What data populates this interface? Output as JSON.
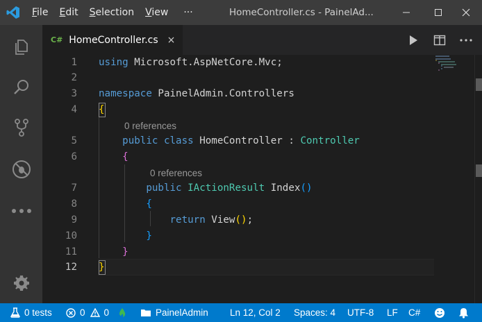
{
  "titlebar": {
    "menu": [
      {
        "label": "File",
        "accel": "F"
      },
      {
        "label": "Edit",
        "accel": "E"
      },
      {
        "label": "Selection",
        "accel": "S"
      },
      {
        "label": "View",
        "accel": "V"
      }
    ],
    "more": "···",
    "window_title": "HomeController.cs - PainelAd..."
  },
  "tab": {
    "lang_badge": "C#",
    "label": "HomeController.cs",
    "close": "×"
  },
  "editor": {
    "lines": [
      {
        "n": "1",
        "tokens": [
          {
            "t": "using",
            "c": "kw"
          },
          {
            "t": " Microsoft.AspNetCore.Mvc;",
            "c": ""
          }
        ]
      },
      {
        "n": "2",
        "tokens": []
      },
      {
        "n": "3",
        "tokens": [
          {
            "t": "namespace",
            "c": "kw"
          },
          {
            "t": " PainelAdmin.Controllers",
            "c": ""
          }
        ]
      },
      {
        "n": "4",
        "tokens": [
          {
            "t": "{",
            "c": "br1"
          }
        ]
      },
      {
        "n": "5",
        "lens": "0 references",
        "tokens": [
          {
            "t": "    public",
            "c": "kw"
          },
          {
            "t": " ",
            "c": ""
          },
          {
            "t": "class",
            "c": "kw"
          },
          {
            "t": " HomeController : ",
            "c": ""
          },
          {
            "t": "Controller",
            "c": "ty"
          }
        ]
      },
      {
        "n": "6",
        "tokens": [
          {
            "t": "    {",
            "c": "br2"
          }
        ]
      },
      {
        "n": "7",
        "lens": "0 references",
        "tokens": [
          {
            "t": "        public",
            "c": "kw"
          },
          {
            "t": " ",
            "c": ""
          },
          {
            "t": "IActionResult",
            "c": "ty"
          },
          {
            "t": " Index",
            "c": ""
          },
          {
            "t": "()",
            "c": "br3"
          }
        ]
      },
      {
        "n": "8",
        "tokens": [
          {
            "t": "        {",
            "c": "br3"
          }
        ]
      },
      {
        "n": "9",
        "tokens": [
          {
            "t": "            return",
            "c": "kw"
          },
          {
            "t": " View",
            "c": ""
          },
          {
            "t": "()",
            "c": "br1"
          },
          {
            "t": ";",
            "c": ""
          }
        ]
      },
      {
        "n": "10",
        "tokens": [
          {
            "t": "        }",
            "c": "br3"
          }
        ]
      },
      {
        "n": "11",
        "tokens": [
          {
            "t": "    }",
            "c": "br2"
          }
        ]
      },
      {
        "n": "12",
        "tokens": [
          {
            "t": "}",
            "c": "br1"
          }
        ]
      }
    ]
  },
  "statusbar": {
    "tests": "0 tests",
    "errors": "0",
    "warnings": "0",
    "folder": "PainelAdmin",
    "position": "Ln 12, Col 2",
    "spaces": "Spaces: 4",
    "encoding": "UTF-8",
    "eol": "LF",
    "language": "C#"
  },
  "colors": {
    "statusbar_bg": "#007acc",
    "keyword": "#569cd6",
    "type": "#4ec9b0",
    "bracket_gold": "#ffd700",
    "bracket_orchid": "#da70d6",
    "bracket_blue": "#179fff"
  },
  "icons": [
    "vscode-logo-icon",
    "explorer-icon",
    "search-icon",
    "source-control-icon",
    "debug-icon",
    "more-icon",
    "gear-icon",
    "run-icon",
    "split-editor-icon",
    "beaker-icon",
    "error-icon",
    "warning-icon",
    "flame-icon",
    "folder-icon",
    "smiley-icon",
    "bell-icon"
  ]
}
